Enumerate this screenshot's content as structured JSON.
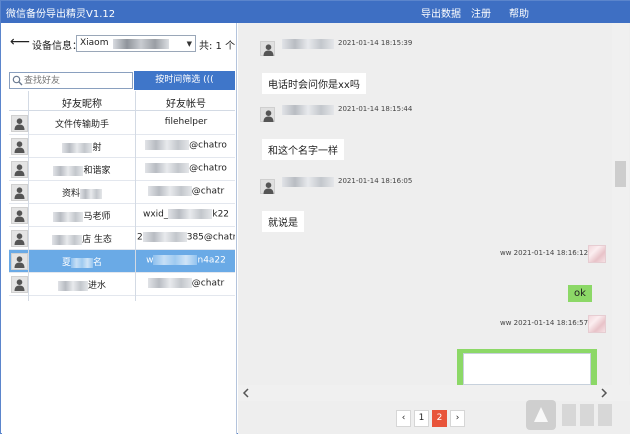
{
  "window": {
    "title": "微信备份导出精灵V1.12",
    "menu": [
      "导出数据",
      "注册",
      "帮助"
    ]
  },
  "device": {
    "back_glyph": "⟵",
    "label": "设备信息：",
    "selected": "Xiaom",
    "count": "共: 1 个"
  },
  "search": {
    "placeholder": "查找好友",
    "value": "",
    "filter_button": "按时间筛选 ((("
  },
  "contacts": {
    "headers": [
      "好友昵称",
      "好友帐号"
    ],
    "rows": [
      {
        "name_pre": "",
        "name_post": "文件传输助手",
        "acct_pre": "",
        "acct_post": "filehelper",
        "selected": false
      },
      {
        "name_pre": "",
        "name_post": "射",
        "acct_pre": "",
        "acct_post": "@chatro",
        "selected": false
      },
      {
        "name_pre": "",
        "name_post": "和谐家",
        "acct_pre": "",
        "acct_post": "@chatro",
        "selected": false
      },
      {
        "name_pre": "资料",
        "name_post": "",
        "acct_pre": "",
        "acct_post": "@chatr",
        "selected": false
      },
      {
        "name_pre": "",
        "name_post": "马老师",
        "acct_pre": "wxid_",
        "acct_post": "k22",
        "selected": false
      },
      {
        "name_pre": "",
        "name_post": "店 生态",
        "acct_pre": "2",
        "acct_post": "385@chatr",
        "selected": false
      },
      {
        "name_pre": "夏",
        "name_post": "名",
        "acct_pre": "w",
        "acct_post": "n4a22",
        "selected": true
      },
      {
        "name_pre": "",
        "name_post": "进水",
        "acct_pre": "",
        "acct_post": "@chatr",
        "selected": false
      }
    ]
  },
  "chat": {
    "messages": [
      {
        "side": "left",
        "time": "2021-01-14 18:15:39",
        "text": "电话时会问你是xx吗"
      },
      {
        "side": "left",
        "time": "2021-01-14 18:15:44",
        "text": "和这个名字一样"
      },
      {
        "side": "left",
        "time": "2021-01-14 18:16:05",
        "text": "就说是"
      },
      {
        "side": "right",
        "sender": "ww",
        "time": "2021-01-14 18:16:12",
        "text": "ok"
      },
      {
        "side": "right",
        "sender": "ww",
        "time": "2021-01-14 18:16:57",
        "text": ""
      }
    ]
  },
  "pager": {
    "prev": "‹",
    "pages": [
      "1",
      "2"
    ],
    "current": "2",
    "next": "›"
  },
  "colors": {
    "titlebar": "#3e6fc3",
    "selected_row": "#6aaae6",
    "bubble_me": "#8cd867",
    "current_page": "#e8543a"
  },
  "icons": [
    "back-arrow-icon",
    "search-icon",
    "dropdown-arrow-icon",
    "user-avatar-icon",
    "scroll-left-icon",
    "scroll-right-icon",
    "watermark-logo-icon"
  ]
}
